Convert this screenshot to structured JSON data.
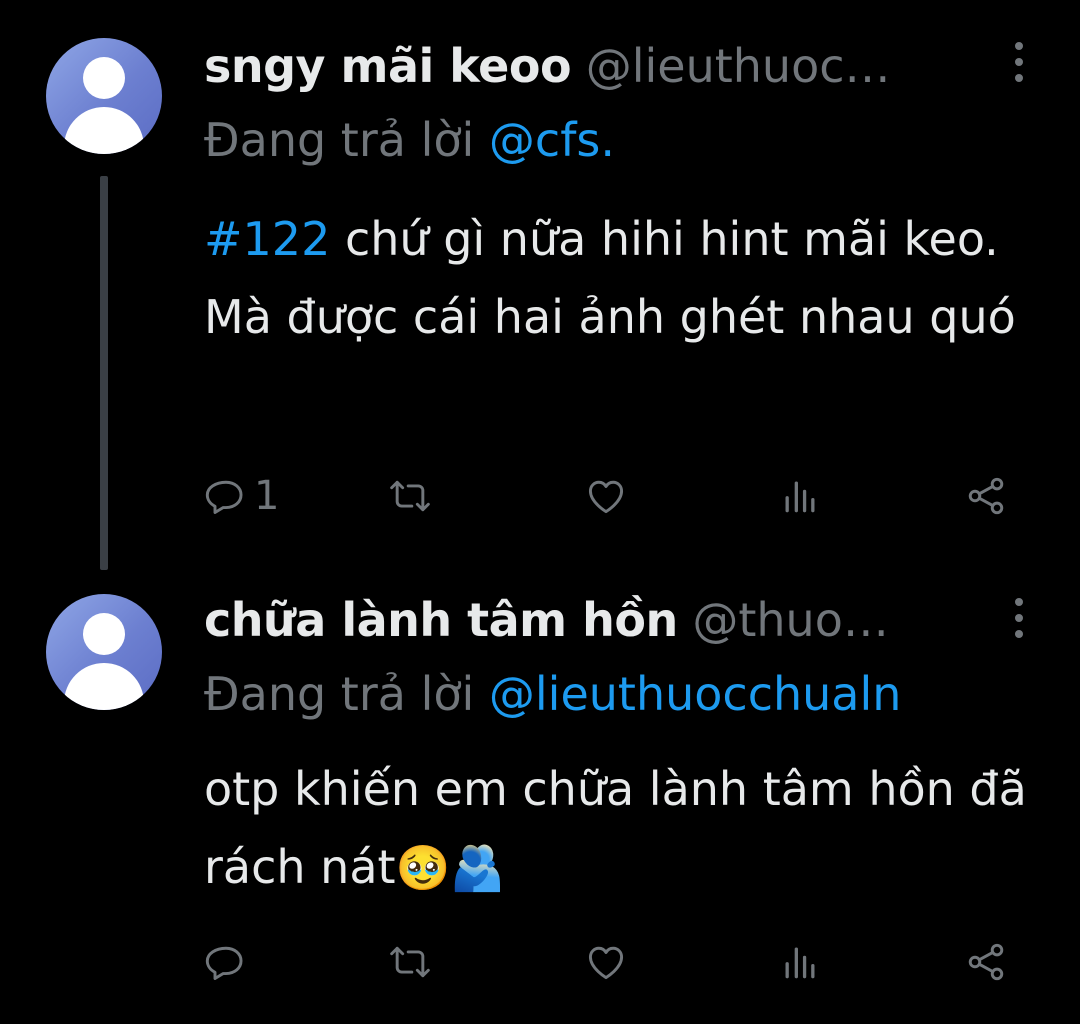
{
  "tweets": [
    {
      "display_name": "sngy mãi keoo",
      "handle": "@lieuthuoc…",
      "reply_prefix": "Đang trả lời ",
      "reply_mention": "@cfs.",
      "hashtag": "#122",
      "text": " chứ gì nữa hihi hint mãi keo. Mà được cái hai ảnh ghét nhau quó",
      "emoji_1": "",
      "emoji_2": "",
      "reply_count": "1",
      "icons": [
        "more-vertical-icon",
        "reply-icon",
        "retweet-icon",
        "like-icon",
        "views-icon",
        "share-icon"
      ]
    },
    {
      "display_name": "chữa lành tâm hồn",
      "handle": "@thuo…",
      "reply_prefix": "Đang trả lời ",
      "reply_mention": "@lieuthuocchualn",
      "hashtag": "",
      "text": "otp khiến em chữa lành tâm hồn đã rách nát",
      "emoji_1": "🥹",
      "emoji_2": "🫂",
      "reply_count": "",
      "icons": [
        "more-vertical-icon",
        "reply-icon",
        "retweet-icon",
        "like-icon",
        "views-icon",
        "share-icon"
      ]
    }
  ],
  "colors": {
    "background": "#000000",
    "primary_text": "#e7e9ea",
    "secondary_text": "#71767b",
    "accent": "#1d9bf0",
    "avatar": "#6c7fd0"
  }
}
